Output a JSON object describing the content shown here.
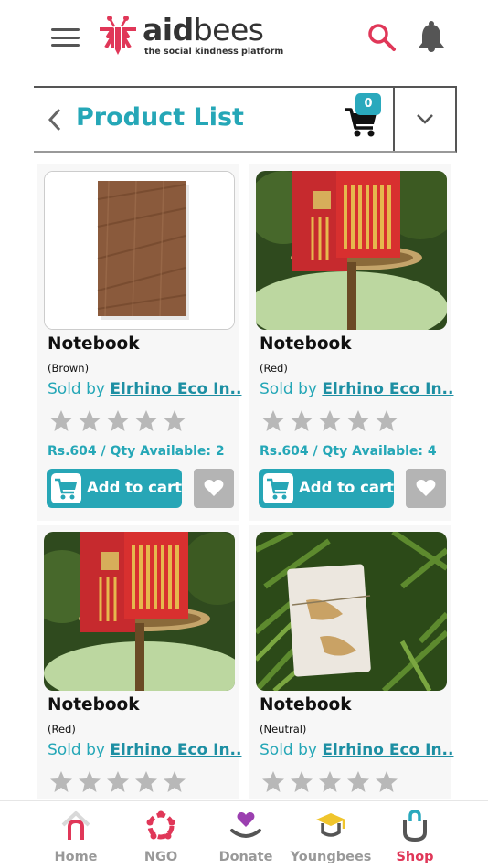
{
  "header": {
    "brand_aid": "aid",
    "brand_bees": "bees",
    "tagline": "the social kindness platform"
  },
  "titlebar": {
    "title": "Product List",
    "cart_count": "0"
  },
  "products": [
    {
      "name": "Notebook",
      "variant": "(Brown)",
      "sold_by_prefix": "Sold by ",
      "seller": "Elrhino Eco In..",
      "rating": 0,
      "price_line": "Rs.604 / Qty Available: 2",
      "add_label": "Add to cart"
    },
    {
      "name": "Notebook",
      "variant": "(Red)",
      "sold_by_prefix": "Sold by ",
      "seller": "Elrhino Eco In..",
      "rating": 0,
      "price_line": "Rs.604 / Qty Available: 4",
      "add_label": "Add to cart"
    },
    {
      "name": "Notebook",
      "variant": "(Red)",
      "sold_by_prefix": "Sold by ",
      "seller": "Elrhino Eco In..",
      "rating": 0
    },
    {
      "name": "Notebook",
      "variant": "(Neutral)",
      "sold_by_prefix": "Sold by ",
      "seller": "Elrhino Eco In..",
      "rating": 0
    }
  ],
  "bottom_nav": [
    {
      "label": "Home",
      "icon": "home-icon"
    },
    {
      "label": "NGO",
      "icon": "ngo-icon"
    },
    {
      "label": "Donate",
      "icon": "donate-icon"
    },
    {
      "label": "Youngbees",
      "icon": "youngbees-icon"
    },
    {
      "label": "Shop",
      "icon": "shop-icon",
      "active": true
    }
  ],
  "colors": {
    "accent": "#25a7b7",
    "brand_red": "#e03758",
    "star_gray": "#b8b8b8",
    "wishlist_gray": "#b4b4b4"
  }
}
